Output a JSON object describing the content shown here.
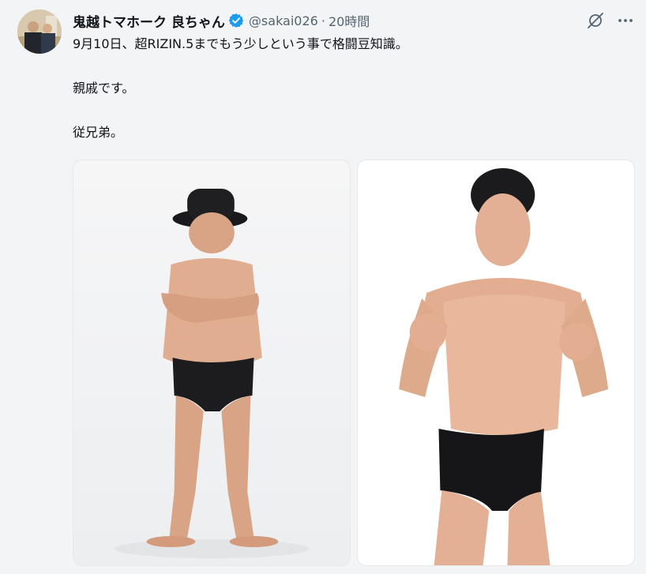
{
  "author": {
    "display_name": "鬼越トマホーク 良ちゃん",
    "handle": "@sakai026",
    "separator": "·",
    "time": "20時間",
    "verified_color": "#1d9bf0"
  },
  "tweet": {
    "paragraphs": [
      "9月10日、超RIZIN.5までもう少しという事で格闘豆知識。",
      "親戚です。",
      "従兄弟。"
    ]
  },
  "media": {
    "count": 2
  },
  "icons": {
    "grok": "grok-icon",
    "more": "more-icon",
    "verified": "verified-badge-icon"
  }
}
